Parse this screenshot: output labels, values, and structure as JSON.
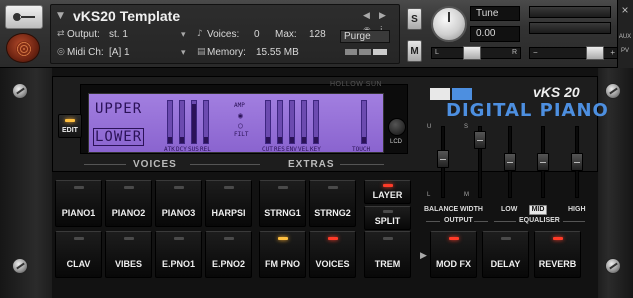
{
  "header": {
    "instrument_name": "vKS20 Template",
    "output_label": "Output:",
    "output_value": "st. 1",
    "voices_label": "Voices:",
    "voices_value": "0",
    "max_label": "Max:",
    "max_value": "128",
    "purge_label": "Purge",
    "midi_label": "Midi Ch:",
    "midi_value": "[A]  1",
    "memory_label": "Memory:",
    "memory_value": "15.55 MB",
    "s_label": "S",
    "m_label": "M",
    "tune_label": "Tune",
    "tune_value": "0.00",
    "pan_left": "L",
    "pan_right": "R",
    "aux_label": "AUX",
    "pv_label": "PV",
    "close_label": "×"
  },
  "lcd": {
    "brand": "HOLLOW SUN",
    "upper": "UPPER",
    "lower": "LOWER",
    "amp": "AMP",
    "filt": "FILT",
    "voice_params": [
      "ATK",
      "DCY",
      "SUS",
      "REL"
    ],
    "extra_params": [
      "CUT",
      "RES",
      "ENV",
      "VEL",
      "KEY"
    ],
    "touch": "TOUCH",
    "voice_levels": [
      0.15,
      0.15,
      0.92,
      0.15
    ],
    "extra_levels": [
      0.15,
      0.15,
      0.15,
      0.15,
      0.15
    ],
    "touch_level": 0.15,
    "lcd_knob_label": "LCD"
  },
  "edit_label": "EDIT",
  "sections": {
    "voices": "VOICES",
    "extras": "EXTRAS",
    "output": "OUTPUT",
    "equaliser": "EQUALISER"
  },
  "logo": {
    "model": "vKS 20",
    "name": "DIGITAL PIANO"
  },
  "faders": {
    "balance": {
      "label": "BALANCE",
      "top": "U",
      "bottom": "L",
      "value": 0.55
    },
    "width": {
      "label": "WIDTH",
      "top": "S",
      "bottom": "M",
      "value": 0.9
    },
    "low": {
      "label": "LOW",
      "value": 0.5
    },
    "mid": {
      "label": "MID",
      "value": 0.5
    },
    "high": {
      "label": "HIGH",
      "value": 0.5
    }
  },
  "voices_row1": [
    "PIANO1",
    "PIANO2",
    "PIANO3",
    "HARPSI"
  ],
  "voices_row2": [
    "CLAV",
    "VIBES",
    "E.PNO1",
    "E.PNO2"
  ],
  "extras_row1": [
    "STRNG1",
    "STRNG2"
  ],
  "extras_row2": [
    "FM PNO",
    "VOICES"
  ],
  "layer": {
    "layer": "LAYER",
    "split": "SPLIT"
  },
  "effects": [
    "TREM",
    "MOD FX",
    "DELAY",
    "REVERB"
  ],
  "colors": {
    "led_on": "#ff3b28",
    "led_amber": "#ffc040",
    "lcd": "#9b77db",
    "brand_blue": "#4d8fe0"
  }
}
